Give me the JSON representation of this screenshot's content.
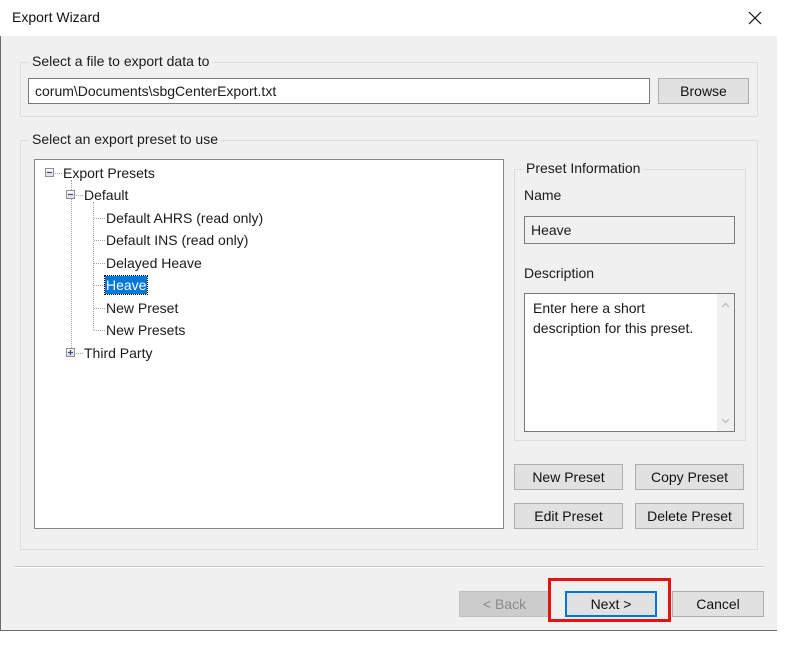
{
  "window": {
    "title": "Export Wizard",
    "close_icon": "close-icon"
  },
  "file_section": {
    "legend": "Select a file to export data to",
    "path_value": "corum\\Documents\\sbgCenterExport.txt",
    "browse_label": "Browse"
  },
  "preset_section": {
    "legend": "Select an export preset to use",
    "tree": {
      "root": {
        "label": "Export Presets",
        "expanded": true
      },
      "groups": [
        {
          "label": "Default",
          "expanded": true,
          "children": [
            {
              "label": "Default AHRS (read only)",
              "selected": false
            },
            {
              "label": "Default INS (read only)",
              "selected": false
            },
            {
              "label": "Delayed Heave",
              "selected": false
            },
            {
              "label": "Heave",
              "selected": true
            },
            {
              "label": "New Preset",
              "selected": false
            },
            {
              "label": "New Presets",
              "selected": false
            }
          ]
        },
        {
          "label": "Third Party",
          "expanded": false,
          "children": []
        }
      ]
    },
    "info": {
      "legend": "Preset Information",
      "name_label": "Name",
      "name_value": "Heave",
      "description_label": "Description",
      "description_value": "Enter here a short description for this preset."
    },
    "buttons": {
      "new_preset": "New Preset",
      "copy_preset": "Copy Preset",
      "edit_preset": "Edit Preset",
      "delete_preset": "Delete Preset"
    }
  },
  "footer": {
    "back_label": "< Back",
    "back_enabled": false,
    "next_label": "Next >",
    "cancel_label": "Cancel"
  },
  "colors": {
    "selection": "#0078d7",
    "highlight_box": "#e41212",
    "dialog_bg": "#f0f0f0"
  }
}
